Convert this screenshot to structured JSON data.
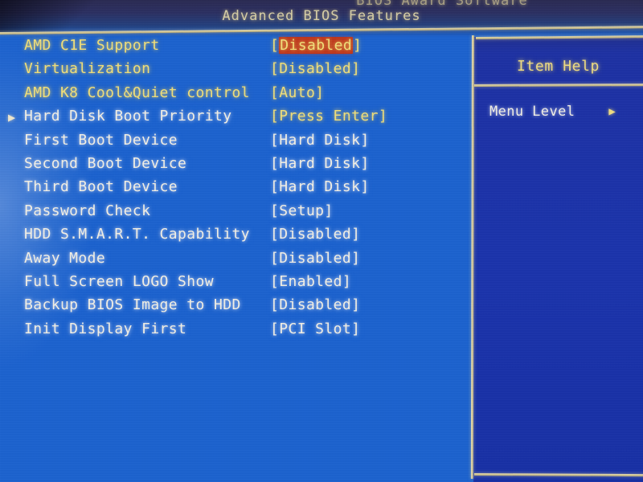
{
  "screen": {
    "title_cut_off": "BIOS Award Software",
    "title": "Advanced BIOS Features",
    "background_color": "#1b62d0",
    "panel_color": "#1a33ad",
    "border_color": "#ddd2a4",
    "highlight_color": "#c0341c",
    "white_text_color": "#f4f1e6",
    "yellow_text_color": "#f2e07a"
  },
  "settings": {
    "rows": [
      {
        "pointer": "",
        "label": "AMD C1E Support",
        "label_color": "yellow",
        "value": "[Disabled]",
        "value_color": "yellow",
        "highlighted": true,
        "highlight_text": "Disabled"
      },
      {
        "pointer": "",
        "label": "Virtualization",
        "label_color": "yellow",
        "value": "[Disabled]",
        "value_color": "yellow",
        "highlighted": false,
        "highlight_text": ""
      },
      {
        "pointer": "",
        "label": "AMD K8 Cool&Quiet control",
        "label_color": "yellow",
        "value": "[Auto]",
        "value_color": "yellow",
        "highlighted": false,
        "highlight_text": ""
      },
      {
        "pointer": "▶",
        "label": "Hard Disk Boot Priority",
        "label_color": "white",
        "value": "[Press Enter]",
        "value_color": "yellow",
        "highlighted": false,
        "highlight_text": ""
      },
      {
        "pointer": "",
        "label": "First Boot Device",
        "label_color": "white",
        "value": "[Hard Disk]",
        "value_color": "white",
        "highlighted": false,
        "highlight_text": ""
      },
      {
        "pointer": "",
        "label": "Second Boot Device",
        "label_color": "white",
        "value": "[Hard Disk]",
        "value_color": "white",
        "highlighted": false,
        "highlight_text": ""
      },
      {
        "pointer": "",
        "label": "Third Boot Device",
        "label_color": "white",
        "value": "[Hard Disk]",
        "value_color": "white",
        "highlighted": false,
        "highlight_text": ""
      },
      {
        "pointer": "",
        "label": "Password Check",
        "label_color": "white",
        "value": "[Setup]",
        "value_color": "white",
        "highlighted": false,
        "highlight_text": ""
      },
      {
        "pointer": "",
        "label": "HDD S.M.A.R.T. Capability",
        "label_color": "white",
        "value": "[Disabled]",
        "value_color": "white",
        "highlighted": false,
        "highlight_text": ""
      },
      {
        "pointer": "",
        "label": "Away Mode",
        "label_color": "white",
        "value": "[Disabled]",
        "value_color": "white",
        "highlighted": false,
        "highlight_text": ""
      },
      {
        "pointer": "",
        "label": "Full Screen LOGO Show",
        "label_color": "white",
        "value": "[Enabled]",
        "value_color": "white",
        "highlighted": false,
        "highlight_text": ""
      },
      {
        "pointer": "",
        "label": "Backup BIOS Image to HDD",
        "label_color": "white",
        "value": "[Disabled]",
        "value_color": "white",
        "highlighted": false,
        "highlight_text": ""
      },
      {
        "pointer": "",
        "label": "Init Display First",
        "label_color": "white",
        "value": "[PCI Slot]",
        "value_color": "white",
        "highlighted": false,
        "highlight_text": ""
      }
    ]
  },
  "item_help": {
    "title": "Item Help",
    "menu_level_label": "Menu Level",
    "menu_level_arrow": "▶"
  }
}
